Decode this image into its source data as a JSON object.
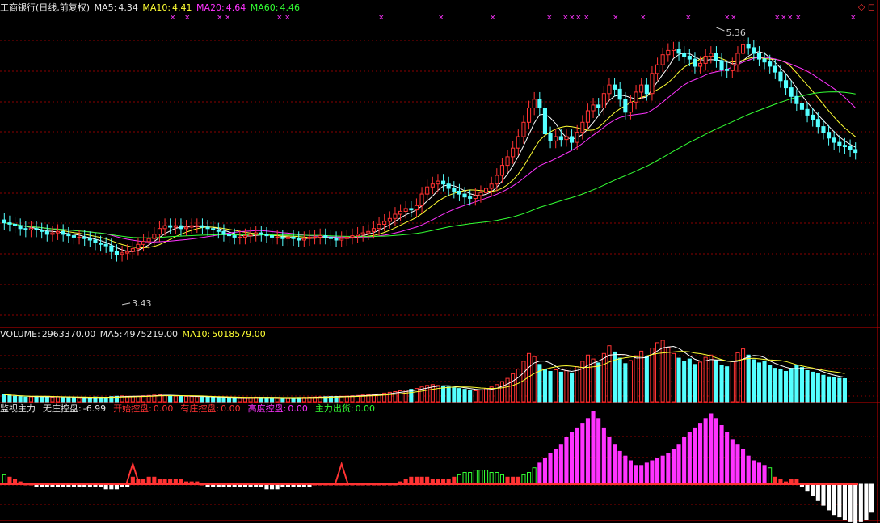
{
  "price_panel": {
    "name": "工商银行(日线,前复权)",
    "ma5_label": "MA5:",
    "ma5_value": "4.34",
    "ma10_label": "MA10:",
    "ma10_value": "4.41",
    "ma20_label": "MA20:",
    "ma20_value": "4.64",
    "ma60_label": "MA60:",
    "ma60_value": "4.46",
    "high_label": "5.36",
    "low_label": "3.43"
  },
  "volume_panel": {
    "title": "VOLUME:",
    "volume_value": "2963370.00",
    "ma5_label": "MA5:",
    "ma5_value": "4975219.00",
    "ma10_label": "MA10:",
    "ma10_value": "5018579.00"
  },
  "indicator_panel": {
    "title": "监视主力",
    "wzk_label": "无庄控盘:",
    "wzk_value": "-6.99",
    "kszp_label": "开始控盘:",
    "kszp_value": "0.00",
    "yzkp_label": "有庄控盘:",
    "yzkp_value": "0.00",
    "gdkp_label": "高度控盘:",
    "gdkp_value": "0.00",
    "zlch_label": "主力出货:",
    "zlch_value": "0.00"
  },
  "colors": {
    "up": "#ff3333",
    "down": "#54ffff",
    "ma5": "#ffffff",
    "ma10": "#ffff33",
    "ma20": "#ff33ff",
    "ma60": "#33ff33",
    "grid": "#8b0000"
  },
  "chart_data": [
    {
      "type": "candlestick",
      "title": "工商银行(日线,前复权)",
      "ylim": [
        3.3,
        5.45
      ],
      "annotations": [
        {
          "text": "5.36",
          "bar": 133
        },
        {
          "text": "3.43",
          "bar": 22
        }
      ],
      "series": [
        {
          "name": "K",
          "open": [
            4.02,
            4.0,
            3.99,
            3.98,
            3.96,
            3.95,
            3.96,
            3.95,
            3.94,
            3.92,
            3.93,
            3.94,
            3.92,
            3.91,
            3.9,
            3.9,
            3.89,
            3.88,
            3.86,
            3.85,
            3.84,
            3.8,
            3.78,
            3.79,
            3.8,
            3.82,
            3.85,
            3.87,
            3.89,
            3.92,
            3.96,
            3.98,
            3.97,
            3.98,
            3.96,
            3.97,
            3.98,
            3.98,
            3.97,
            3.96,
            3.95,
            3.94,
            3.92,
            3.91,
            3.9,
            3.9,
            3.91,
            3.92,
            3.93,
            3.92,
            3.91,
            3.9,
            3.9,
            3.89,
            3.9,
            3.89,
            3.88,
            3.89,
            3.9,
            3.9,
            3.91,
            3.9,
            3.89,
            3.88,
            3.89,
            3.9,
            3.91,
            3.92,
            3.93,
            3.94,
            3.96,
            3.99,
            4.01,
            4.03,
            4.06,
            4.08,
            4.1,
            4.09,
            4.12,
            4.2,
            4.25,
            4.27,
            4.29,
            4.27,
            4.24,
            4.22,
            4.2,
            4.18,
            4.17,
            4.19,
            4.21,
            4.24,
            4.27,
            4.33,
            4.4,
            4.46,
            4.52,
            4.6,
            4.7,
            4.8,
            4.86,
            4.8,
            4.62,
            4.57,
            4.6,
            4.58,
            4.6,
            4.56,
            4.63,
            4.7,
            4.78,
            4.82,
            4.8,
            4.9,
            4.96,
            4.93,
            4.86,
            4.77,
            4.84,
            4.91,
            4.96,
            4.9,
            5.04,
            5.1,
            5.17,
            5.2,
            5.21,
            5.18,
            5.16,
            5.14,
            5.09,
            5.11,
            5.16,
            5.18,
            5.13,
            5.07,
            5.06,
            5.1,
            5.18,
            5.24,
            5.22,
            5.18,
            5.14,
            5.12,
            5.09,
            5.05,
            4.99,
            4.94,
            4.88,
            4.83,
            4.79,
            4.75,
            4.72,
            4.67,
            4.63,
            4.59,
            4.56,
            4.54,
            4.53,
            4.51
          ],
          "close": [
            4.0,
            3.99,
            3.98,
            3.96,
            3.95,
            3.96,
            3.95,
            3.94,
            3.92,
            3.93,
            3.94,
            3.92,
            3.91,
            3.9,
            3.9,
            3.89,
            3.88,
            3.86,
            3.85,
            3.84,
            3.8,
            3.78,
            3.79,
            3.8,
            3.82,
            3.85,
            3.87,
            3.89,
            3.92,
            3.96,
            3.98,
            3.97,
            3.98,
            3.96,
            3.97,
            3.98,
            3.98,
            3.97,
            3.96,
            3.95,
            3.94,
            3.92,
            3.91,
            3.9,
            3.9,
            3.91,
            3.92,
            3.93,
            3.92,
            3.91,
            3.9,
            3.9,
            3.89,
            3.9,
            3.89,
            3.88,
            3.89,
            3.9,
            3.9,
            3.91,
            3.9,
            3.89,
            3.88,
            3.89,
            3.9,
            3.91,
            3.92,
            3.93,
            3.94,
            3.96,
            3.99,
            4.01,
            4.03,
            4.06,
            4.08,
            4.1,
            4.09,
            4.12,
            4.2,
            4.25,
            4.27,
            4.29,
            4.27,
            4.24,
            4.22,
            4.2,
            4.18,
            4.17,
            4.19,
            4.21,
            4.24,
            4.27,
            4.33,
            4.4,
            4.46,
            4.52,
            4.6,
            4.7,
            4.8,
            4.86,
            4.8,
            4.62,
            4.57,
            4.6,
            4.58,
            4.6,
            4.56,
            4.63,
            4.7,
            4.78,
            4.82,
            4.8,
            4.9,
            4.96,
            4.93,
            4.86,
            4.77,
            4.84,
            4.91,
            4.96,
            4.9,
            5.04,
            5.1,
            5.17,
            5.2,
            5.21,
            5.18,
            5.16,
            5.14,
            5.09,
            5.11,
            5.16,
            5.18,
            5.13,
            5.07,
            5.06,
            5.1,
            5.18,
            5.24,
            5.22,
            5.18,
            5.14,
            5.12,
            5.09,
            5.05,
            4.99,
            4.94,
            4.88,
            4.83,
            4.79,
            4.75,
            4.72,
            4.67,
            4.63,
            4.59,
            4.56,
            4.54,
            4.53,
            4.51,
            4.49
          ]
        },
        {
          "name": "MA5"
        },
        {
          "name": "MA10"
        },
        {
          "name": "MA20"
        },
        {
          "name": "MA60"
        }
      ]
    },
    {
      "type": "bar",
      "title": "VOLUME",
      "ylim": [
        0,
        8000000
      ],
      "values": [
        900000,
        800000,
        700000,
        650000,
        600000,
        620000,
        700000,
        650000,
        600000,
        580000,
        640000,
        600000,
        560000,
        540000,
        520000,
        500000,
        540000,
        600000,
        580000,
        560000,
        650000,
        700000,
        750000,
        700000,
        680000,
        720000,
        760000,
        800000,
        850000,
        900000,
        820000,
        760000,
        720000,
        700000,
        680000,
        660000,
        640000,
        620000,
        600000,
        580000,
        560000,
        540000,
        520000,
        500000,
        520000,
        540000,
        560000,
        580000,
        560000,
        540000,
        520000,
        500000,
        480000,
        500000,
        520000,
        540000,
        560000,
        580000,
        600000,
        620000,
        640000,
        660000,
        680000,
        700000,
        720000,
        760000,
        800000,
        860000,
        900000,
        950000,
        1000000,
        1100000,
        1200000,
        1300000,
        1400000,
        1500000,
        1600000,
        1700000,
        1900000,
        2100000,
        2200000,
        2100000,
        2000000,
        1900000,
        1800000,
        1700000,
        1600000,
        1500000,
        1400000,
        1500000,
        1700000,
        1900000,
        2200000,
        2600000,
        3000000,
        3600000,
        4200000,
        5200000,
        6200000,
        5800000,
        4800000,
        4200000,
        3900000,
        4100000,
        3800000,
        4000000,
        3700000,
        4500000,
        5200000,
        6000000,
        5500000,
        5000000,
        6200000,
        7200000,
        6400000,
        5600000,
        4900000,
        5300000,
        5900000,
        6500000,
        5800000,
        6900000,
        7600000,
        7900000,
        7000000,
        6200000,
        5600000,
        5200000,
        5500000,
        4800000,
        5100000,
        5700000,
        6000000,
        5300000,
        4700000,
        4500000,
        5200000,
        6300000,
        6800000,
        6000000,
        5400000,
        5000000,
        5200000,
        4700000,
        4300000,
        4100000,
        3900000,
        4300000,
        4700000,
        4400000,
        4000000,
        3800000,
        3600000,
        3400000,
        3200000,
        3100000,
        3000000,
        2963370
      ]
    },
    {
      "type": "bar",
      "title": "监视主力",
      "ylim": [
        -20,
        30
      ],
      "values": [
        4,
        3,
        2,
        1,
        0,
        0,
        -1,
        -1,
        -1,
        -1,
        -1,
        -1,
        -1,
        -1,
        -1,
        -1,
        -1,
        -1,
        -1,
        -2,
        -2,
        -2,
        -1,
        -1,
        3,
        2,
        2,
        3,
        3,
        2,
        2,
        2,
        2,
        2,
        1,
        1,
        1,
        0,
        -1,
        -1,
        -1,
        -1,
        -1,
        -1,
        -1,
        -1,
        -1,
        -1,
        -1,
        -2,
        -2,
        -2,
        -1,
        -1,
        -1,
        -1,
        -1,
        -1,
        0,
        0,
        0,
        0,
        0,
        0,
        0,
        0,
        0,
        0,
        0,
        0,
        0,
        0,
        0,
        0,
        1,
        2,
        3,
        3,
        3,
        3,
        2,
        2,
        2,
        2,
        3,
        4,
        5,
        5,
        6,
        6,
        6,
        5,
        5,
        4,
        3,
        3,
        3,
        4,
        5,
        7,
        9,
        11,
        13,
        15,
        17,
        20,
        22,
        24,
        26,
        28,
        31,
        28,
        24,
        20,
        17,
        14,
        12,
        10,
        8,
        8,
        9,
        10,
        11,
        12,
        13,
        15,
        17,
        20,
        22,
        24,
        26,
        28,
        30,
        28,
        25,
        22,
        19,
        17,
        15,
        12,
        10,
        9,
        8,
        7,
        3,
        2,
        1,
        2,
        2,
        -1,
        -3,
        -5,
        -7,
        -9,
        -11,
        -13,
        -14,
        -15,
        -16,
        -17,
        -16,
        -15,
        -12
      ]
    }
  ]
}
